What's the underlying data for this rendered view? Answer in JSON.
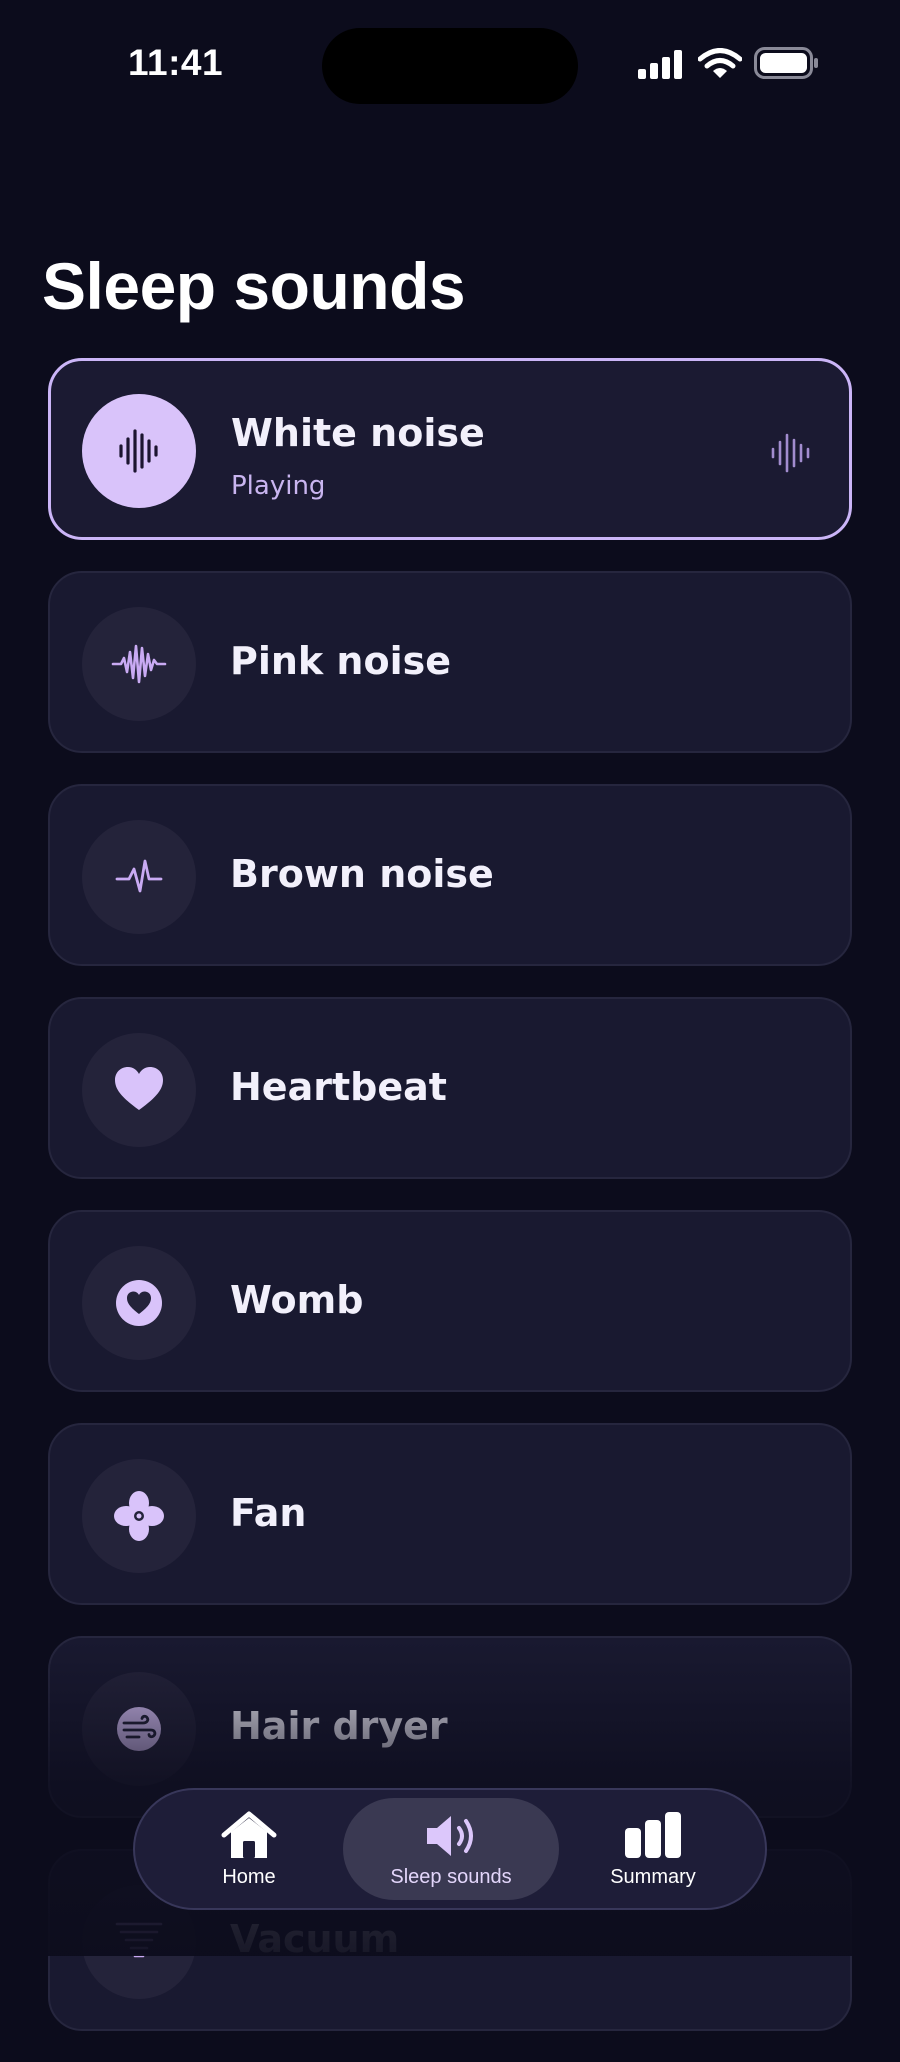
{
  "status_bar": {
    "time": "11:41",
    "icons": [
      "cellular-signal-icon",
      "wifi-icon",
      "battery-icon"
    ]
  },
  "page": {
    "title": "Sleep sounds"
  },
  "sounds": [
    {
      "name": "White noise",
      "status": "Playing",
      "icon": "waveform-icon",
      "active": true
    },
    {
      "name": "Pink noise",
      "icon": "pink-wave-icon",
      "active": false
    },
    {
      "name": "Brown noise",
      "icon": "pulse-icon",
      "active": false
    },
    {
      "name": "Heartbeat",
      "icon": "heart-icon",
      "active": false
    },
    {
      "name": "Womb",
      "icon": "heart-circle-icon",
      "active": false
    },
    {
      "name": "Fan",
      "icon": "fan-icon",
      "active": false
    },
    {
      "name": "Hair dryer",
      "icon": "wind-icon",
      "active": false
    },
    {
      "name": "Vacuum",
      "icon": "tornado-icon",
      "active": false
    }
  ],
  "tab_bar": {
    "tabs": [
      {
        "label": "Home",
        "icon": "house-icon",
        "selected": false
      },
      {
        "label": "Sleep sounds",
        "icon": "speaker-icon",
        "selected": true
      },
      {
        "label": "Summary",
        "icon": "bar-chart-icon",
        "selected": false
      }
    ]
  },
  "colors": {
    "background": "#0c0c1c",
    "card": "#191930",
    "accent": "#d9c3fa",
    "active_border": "#cbb5f7"
  }
}
